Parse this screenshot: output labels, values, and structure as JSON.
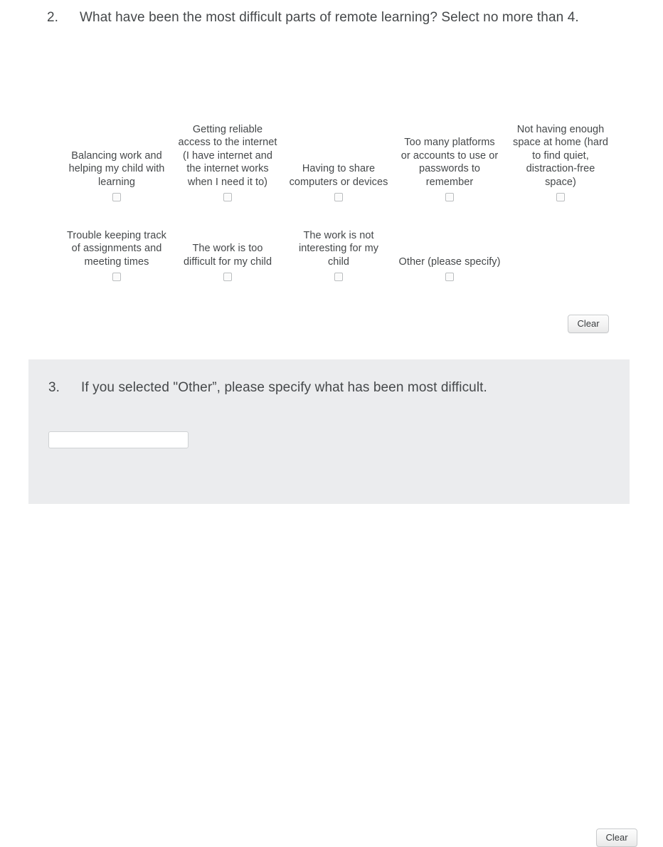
{
  "questions": [
    {
      "number": "2.",
      "text": "What have been the most difficult parts of remote learning? Select no more than 4.",
      "clear_label": "Clear",
      "options_row_1": [
        {
          "label": "Balancing work and helping my child with learning"
        },
        {
          "label": "Getting reliable access to the internet (I have internet and the internet works when I need it to)"
        },
        {
          "label": "Having to share computers or devices"
        },
        {
          "label": "Too many platforms or accounts to use or passwords to remember"
        },
        {
          "label": "Not having enough space at home (hard to find quiet, distraction-free space)"
        }
      ],
      "options_row_2": [
        {
          "label": "Trouble keeping track of assignments and meeting times"
        },
        {
          "label": "The work is too difficult for my child"
        },
        {
          "label": "The work is not interesting for my child"
        },
        {
          "label": "Other (please specify)"
        }
      ]
    },
    {
      "number": "3.",
      "text": "If you selected \"Other”, please specify what has been most difficult.",
      "clear_label": "Clear",
      "answer_value": "",
      "answer_placeholder": ""
    }
  ],
  "colors": {
    "text": "#45484a",
    "panel_background": "#ebecee",
    "page_background": "#ffffff",
    "checkbox_border": "#b9bcbe",
    "button_border": "#c8cacc"
  }
}
